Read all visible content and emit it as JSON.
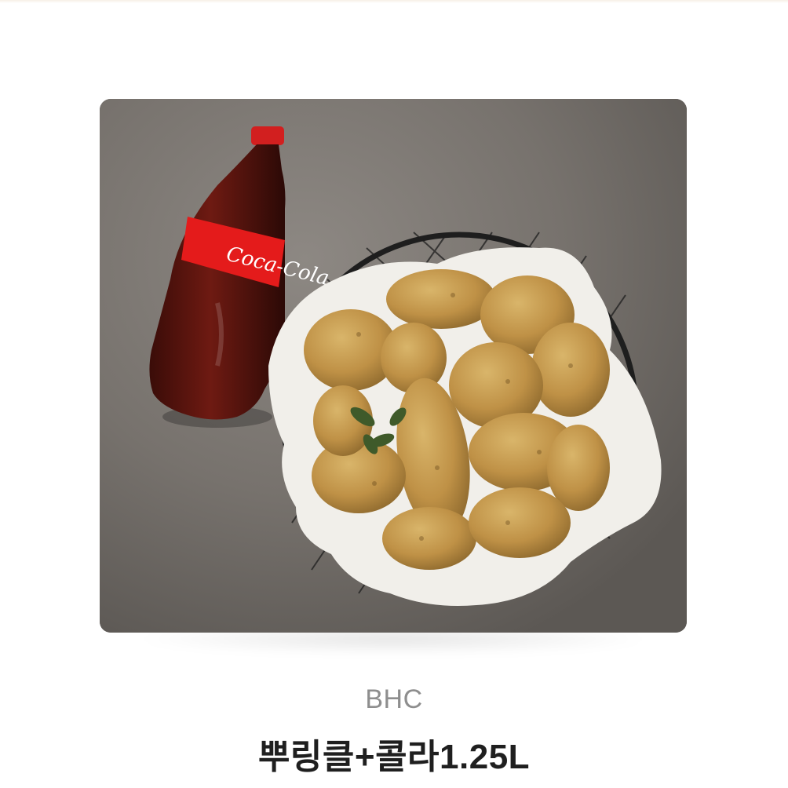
{
  "product": {
    "brand": "BHC",
    "title": "뿌링클+콜라1.25L",
    "image": {
      "depicts": "product-photo",
      "bottle_label_text": "Coca-Cola"
    }
  },
  "colors": {
    "page_background": "#ffffff",
    "brand_text": "#8e8e8e",
    "title_text": "#1f1f1f"
  }
}
